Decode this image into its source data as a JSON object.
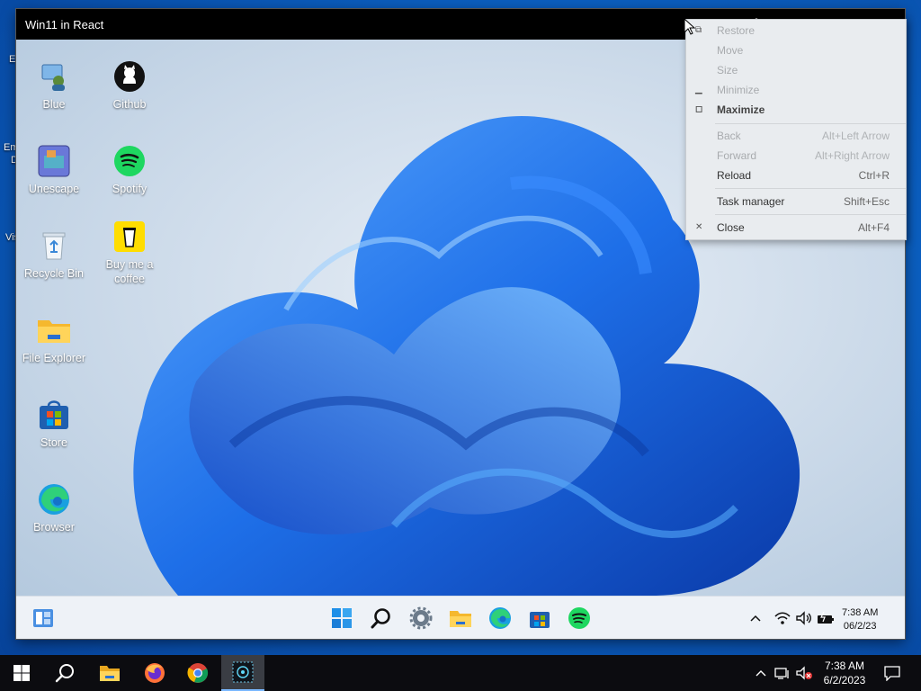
{
  "window": {
    "title": "Win11 in React"
  },
  "host_edge_labels": [
    "E",
    "Em",
    "D",
    "Vis"
  ],
  "desktop_icons": [
    {
      "label": "Blue",
      "icon": "user-computer-icon"
    },
    {
      "label": "Github",
      "icon": "github-icon"
    },
    {
      "label": "Unescape",
      "icon": "unescape-game-icon"
    },
    {
      "label": "Spotify",
      "icon": "spotify-icon"
    },
    {
      "label": "Recycle Bin",
      "icon": "recycle-bin-icon"
    },
    {
      "label": "Buy me a coffee",
      "icon": "coffee-cup-icon"
    },
    {
      "label": "File Explorer",
      "icon": "folder-icon"
    },
    {
      "label": "Store",
      "icon": "store-icon"
    },
    {
      "label": "Browser",
      "icon": "edge-browser-icon"
    }
  ],
  "context_menu": {
    "items": [
      {
        "label": "Restore",
        "shortcut": "",
        "disabled": true
      },
      {
        "label": "Move",
        "shortcut": "",
        "disabled": true
      },
      {
        "label": "Size",
        "shortcut": "",
        "disabled": true
      },
      {
        "label": "Minimize",
        "shortcut": "",
        "disabled": true
      },
      {
        "label": "Maximize",
        "shortcut": "",
        "disabled": false
      },
      {
        "label": "Back",
        "shortcut": "Alt+Left Arrow",
        "disabled": true
      },
      {
        "label": "Forward",
        "shortcut": "Alt+Right Arrow",
        "disabled": true
      },
      {
        "label": "Reload",
        "shortcut": "Ctrl+R",
        "disabled": false
      },
      {
        "label": "Task manager",
        "shortcut": "Shift+Esc",
        "disabled": false
      },
      {
        "label": "Close",
        "shortcut": "Alt+F4",
        "disabled": false
      }
    ]
  },
  "app_taskbar": {
    "time": "7:38 AM",
    "date": "06/2/23"
  },
  "host_taskbar": {
    "time": "7:38 AM",
    "date": "6/2/2023"
  },
  "colors": {
    "accent": "#1e6fd9",
    "spotify": "#1ed760",
    "coffee": "#ffdd00"
  }
}
